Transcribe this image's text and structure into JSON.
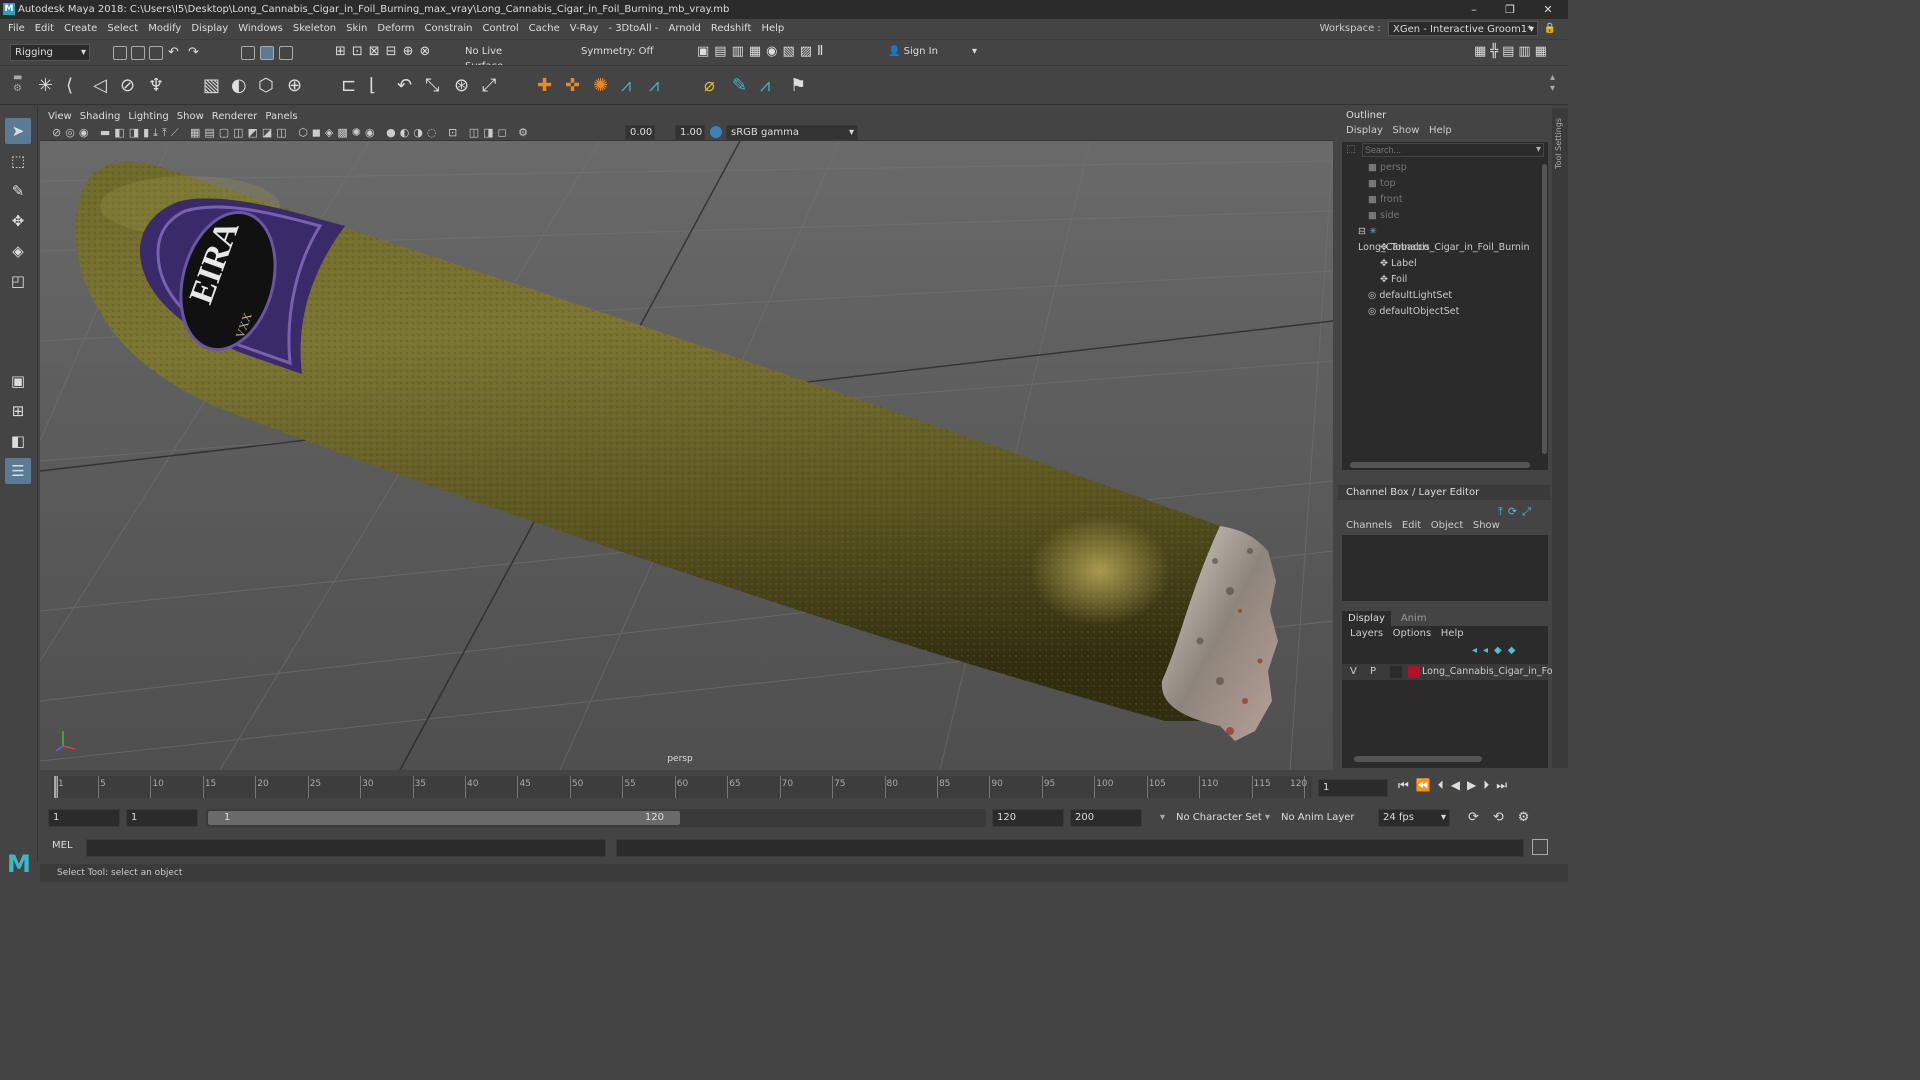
{
  "window": {
    "title": "Autodesk Maya 2018: C:\\Users\\I5\\Desktop\\Long_Cannabis_Cigar_in_Foil_Burning_max_vray\\Long_Cannabis_Cigar_in_Foil_Burning_mb_vray.mb",
    "minimize": "–",
    "maximize": "❐",
    "close": "✕"
  },
  "menubar": {
    "items": [
      "File",
      "Edit",
      "Create",
      "Select",
      "Modify",
      "Display",
      "Windows",
      "Skeleton",
      "Skin",
      "Deform",
      "Constrain",
      "Control",
      "Cache",
      "V-Ray",
      "3DtoAll",
      "Arnold",
      "Redshift",
      "Help"
    ],
    "workspace_label": "Workspace :",
    "workspace_value": "XGen - Interactive Groom1*"
  },
  "statusline": {
    "mode": "Rigging",
    "live_surface": "No Live Surface",
    "symmetry": "Symmetry: Off",
    "sign_in": "Sign In"
  },
  "viewport": {
    "menus": [
      "View",
      "Shading",
      "Lighting",
      "Show",
      "Renderer",
      "Panels"
    ],
    "exposure": "0.00",
    "gamma": "1.00",
    "color_space": "sRGB gamma",
    "camera_label": "persp",
    "label_text": "EIRA",
    "label_subtext": "VXX"
  },
  "outliner": {
    "title": "Outliner",
    "menus": [
      "Display",
      "Show",
      "Help"
    ],
    "search_placeholder": "Search...",
    "items": [
      {
        "label": "persp",
        "type": "camera",
        "indent": 0,
        "dim": true
      },
      {
        "label": "top",
        "type": "camera",
        "indent": 0,
        "dim": true
      },
      {
        "label": "front",
        "type": "camera",
        "indent": 0,
        "dim": true
      },
      {
        "label": "side",
        "type": "camera",
        "indent": 0,
        "dim": true
      },
      {
        "label": "Long_Cannabis_Cigar_in_Foil_Burnin",
        "type": "group",
        "indent": 0,
        "dim": false
      },
      {
        "label": "Tobacco",
        "type": "mesh",
        "indent": 1,
        "dim": false
      },
      {
        "label": "Label",
        "type": "mesh",
        "indent": 1,
        "dim": false
      },
      {
        "label": "Foil",
        "type": "mesh",
        "indent": 1,
        "dim": false
      },
      {
        "label": "defaultLightSet",
        "type": "set",
        "indent": 0,
        "dim": false
      },
      {
        "label": "defaultObjectSet",
        "type": "set",
        "indent": 0,
        "dim": false
      }
    ]
  },
  "channelbox": {
    "title": "Channel Box / Layer Editor",
    "menus": [
      "Channels",
      "Edit",
      "Object",
      "Show"
    ]
  },
  "layers": {
    "tabs": [
      "Display",
      "Anim"
    ],
    "menus": [
      "Layers",
      "Options",
      "Help"
    ],
    "row": {
      "v": "V",
      "p": "P",
      "name": "Long_Cannabis_Cigar_in_Foil_",
      "color": "#b0102a"
    }
  },
  "timeline": {
    "ticks": [
      "1",
      "5",
      "10",
      "15",
      "20",
      "25",
      "30",
      "35",
      "40",
      "45",
      "50",
      "55",
      "60",
      "65",
      "70",
      "75",
      "80",
      "85",
      "90",
      "95",
      "100",
      "105",
      "110",
      "115",
      "120"
    ],
    "current_frame": "1"
  },
  "range": {
    "start": "1",
    "playback_start": "1",
    "slider_start": "1",
    "slider_end": "120",
    "playback_end": "120",
    "end": "200",
    "character_set": "No Character Set",
    "anim_layer": "No Anim Layer",
    "fps": "24 fps"
  },
  "cmdline": {
    "lang": "MEL"
  },
  "helpline": {
    "text": "Select Tool: select an object"
  },
  "side_tab": "Tool Settings"
}
